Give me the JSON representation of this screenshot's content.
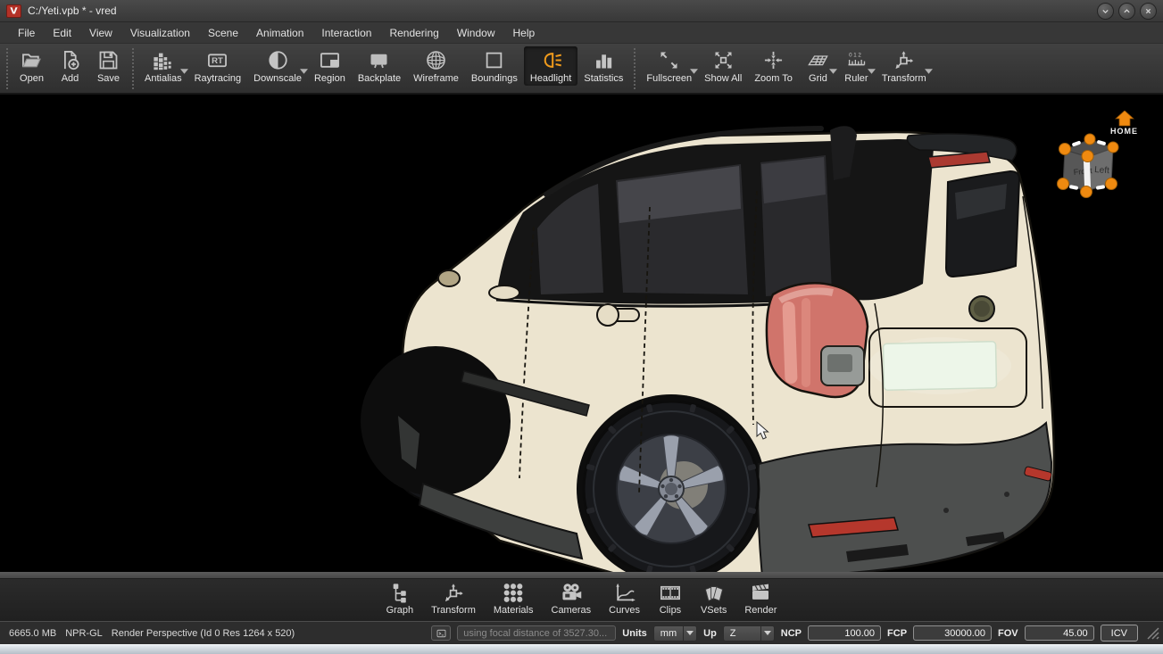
{
  "window": {
    "title": "C:/Yeti.vpb * - vred",
    "app_icon": "vred-logo-icon",
    "controls": [
      {
        "name": "minimize",
        "icon": "chevron-down-icon"
      },
      {
        "name": "maximize",
        "icon": "chevron-up-icon"
      },
      {
        "name": "close",
        "icon": "close-icon"
      }
    ]
  },
  "menu_bar": {
    "items": [
      "File",
      "Edit",
      "View",
      "Visualization",
      "Scene",
      "Animation",
      "Interaction",
      "Rendering",
      "Window",
      "Help"
    ]
  },
  "toolbar": {
    "icon_text": {
      "raytracing": "RT",
      "ruler": "0 1 2"
    },
    "groups": [
      {
        "items": [
          {
            "label": "Open",
            "icon": "open-folder-icon"
          },
          {
            "label": "Add",
            "icon": "add-document-icon"
          },
          {
            "label": "Save",
            "icon": "save-floppy-icon"
          }
        ]
      },
      {
        "items": [
          {
            "label": "Antialias",
            "icon": "antialias-icon",
            "dropdown": true
          },
          {
            "label": "Raytracing",
            "icon": "raytracing-rt-icon"
          },
          {
            "label": "Downscale",
            "icon": "downscale-icon",
            "dropdown": true
          },
          {
            "label": "Region",
            "icon": "region-icon"
          },
          {
            "label": "Backplate",
            "icon": "backplate-icon"
          },
          {
            "label": "Wireframe",
            "icon": "wireframe-globe-icon"
          },
          {
            "label": "Boundings",
            "icon": "boundings-box-icon"
          },
          {
            "label": "Headlight",
            "icon": "headlight-icon",
            "active": true
          },
          {
            "label": "Statistics",
            "icon": "statistics-bars-icon"
          }
        ]
      },
      {
        "items": [
          {
            "label": "Fullscreen",
            "icon": "fullscreen-arrows-icon",
            "dropdown": true
          },
          {
            "label": "Show All",
            "icon": "show-all-icon"
          },
          {
            "label": "Zoom To",
            "icon": "zoom-to-icon"
          },
          {
            "label": "Grid",
            "icon": "grid-plane-icon",
            "dropdown": true
          },
          {
            "label": "Ruler",
            "icon": "ruler-icon",
            "dropdown": true
          },
          {
            "label": "Transform",
            "icon": "transform-gizmo-icon",
            "dropdown": true
          }
        ]
      }
    ]
  },
  "viewport": {
    "model_description": "Skoda Yeti SUV, rear three-quarter view, NPR toon render on black",
    "home_label": "HOME",
    "navcube": {
      "front_label": "Front",
      "left_label": "Left"
    }
  },
  "dock": {
    "items": [
      {
        "label": "Graph",
        "icon": "graph-tree-icon"
      },
      {
        "label": "Transform",
        "icon": "transform-gizmo-icon"
      },
      {
        "label": "Materials",
        "icon": "materials-grid-icon"
      },
      {
        "label": "Cameras",
        "icon": "camera-icon"
      },
      {
        "label": "Curves",
        "icon": "curves-icon"
      },
      {
        "label": "Clips",
        "icon": "filmstrip-icon"
      },
      {
        "label": "VSets",
        "icon": "vsets-cards-icon"
      },
      {
        "label": "Render",
        "icon": "clapperboard-icon"
      }
    ]
  },
  "status_bar": {
    "memory": "6665.0 MB",
    "renderer": "NPR-GL",
    "render_info": "Render Perspective (Id 0 Res 1264 x 520)",
    "message_field": "using focal distance of 3527.30...",
    "units_label": "Units",
    "units_value": "mm",
    "up_label": "Up",
    "up_value": "Z",
    "ncp_label": "NCP",
    "ncp_value": "100.00",
    "fcp_label": "FCP",
    "fcp_value": "30000.00",
    "fov_label": "FOV",
    "fov_value": "45.00",
    "icv_label": "ICV"
  },
  "colors": {
    "accent_orange": "#ef8a10",
    "headlight_icon_orange": "#ef9a1c",
    "toolbar_bg": "#3a3a3a",
    "viewport_bg": "#000000",
    "car_body_cream": "#ece4cf",
    "car_taillight_coral": "#d0746b",
    "car_cladding_gray": "#4d4f4e",
    "vred_logo_red": "#b33127"
  }
}
